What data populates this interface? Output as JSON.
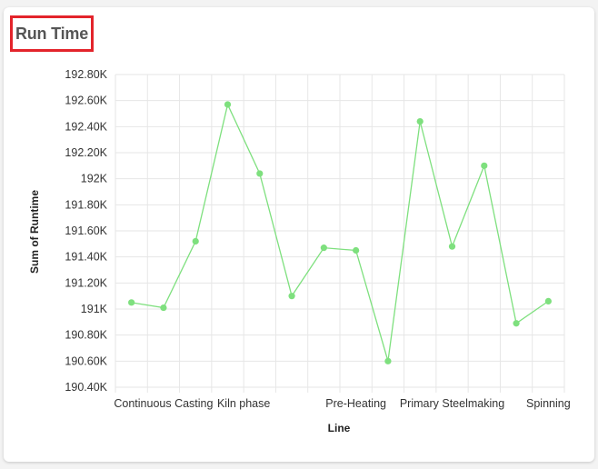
{
  "card": {
    "title": "Run Time"
  },
  "chart_data": {
    "type": "line",
    "title": "Run Time",
    "xlabel": "Line",
    "ylabel": "Sum of Runtime",
    "ylim": [
      190400,
      192800
    ],
    "yticks": [
      {
        "value": 190400,
        "label": "190.40K"
      },
      {
        "value": 190600,
        "label": "190.60K"
      },
      {
        "value": 190800,
        "label": "190.80K"
      },
      {
        "value": 191000,
        "label": "191K"
      },
      {
        "value": 191200,
        "label": "191.20K"
      },
      {
        "value": 191400,
        "label": "191.40K"
      },
      {
        "value": 191600,
        "label": "191.60K"
      },
      {
        "value": 191800,
        "label": "191.80K"
      },
      {
        "value": 192000,
        "label": "192K"
      },
      {
        "value": 192200,
        "label": "192.20K"
      },
      {
        "value": 192400,
        "label": "192.40K"
      },
      {
        "value": 192600,
        "label": "192.60K"
      },
      {
        "value": 192800,
        "label": "192.80K"
      }
    ],
    "xtick_labels": [
      {
        "index": 1.5,
        "label": "Continuous Casting"
      },
      {
        "index": 4,
        "label": "Kiln phase"
      },
      {
        "index": 7.5,
        "label": "Pre-Heating"
      },
      {
        "index": 10.5,
        "label": "Primary Steelmaking"
      },
      {
        "index": 13.5,
        "label": "Spinning"
      }
    ],
    "values": [
      191050,
      191010,
      191520,
      192570,
      192040,
      191100,
      191470,
      191450,
      190600,
      192440,
      191480,
      192100,
      190890,
      191060
    ],
    "grid": true,
    "color": "#7ee07e"
  }
}
